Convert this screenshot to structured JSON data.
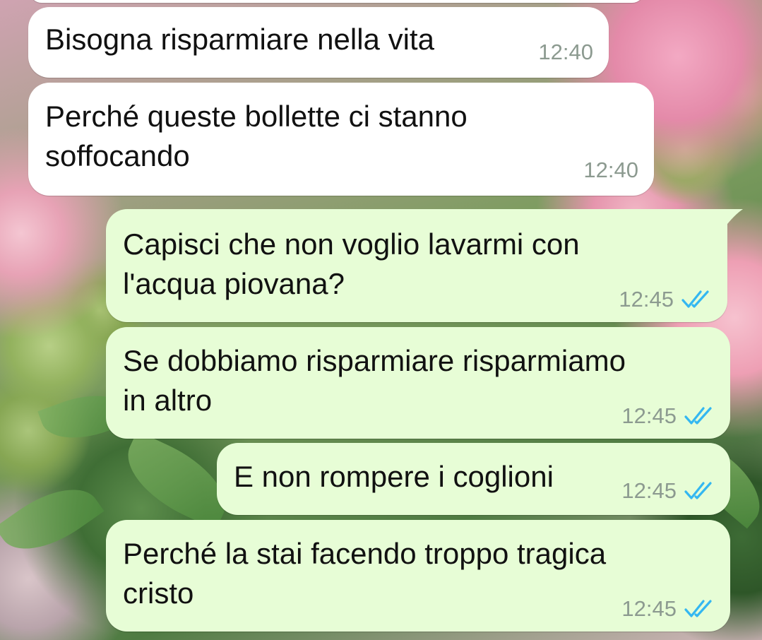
{
  "messages": [
    {
      "text": "Bisogna risparmiare nella vita",
      "time": "12:40",
      "direction": "incoming",
      "status": ""
    },
    {
      "text": "Perché queste bollette ci stanno\nsoffocando",
      "time": "12:40",
      "direction": "incoming",
      "status": ""
    },
    {
      "text": "Capisci che non voglio lavarmi con\nl'acqua piovana?",
      "time": "12:45",
      "direction": "outgoing",
      "status": "read-double-tick-icon"
    },
    {
      "text": "Se dobbiamo risparmiare risparmiamo\nin altro",
      "time": "12:45",
      "direction": "outgoing",
      "status": "read-double-tick-icon"
    },
    {
      "text": "E non rompere i coglioni",
      "time": "12:45",
      "direction": "outgoing",
      "status": "read-double-tick-icon"
    },
    {
      "text": "Perché la stai facendo troppo tragica\ncristo",
      "time": "12:45",
      "direction": "outgoing",
      "status": "read-double-tick-icon"
    }
  ],
  "colors": {
    "incoming_bubble": "#ffffff",
    "outgoing_bubble": "#e7fdd6",
    "read_tick": "#34b7f1",
    "timestamp": "#8c9a90"
  }
}
